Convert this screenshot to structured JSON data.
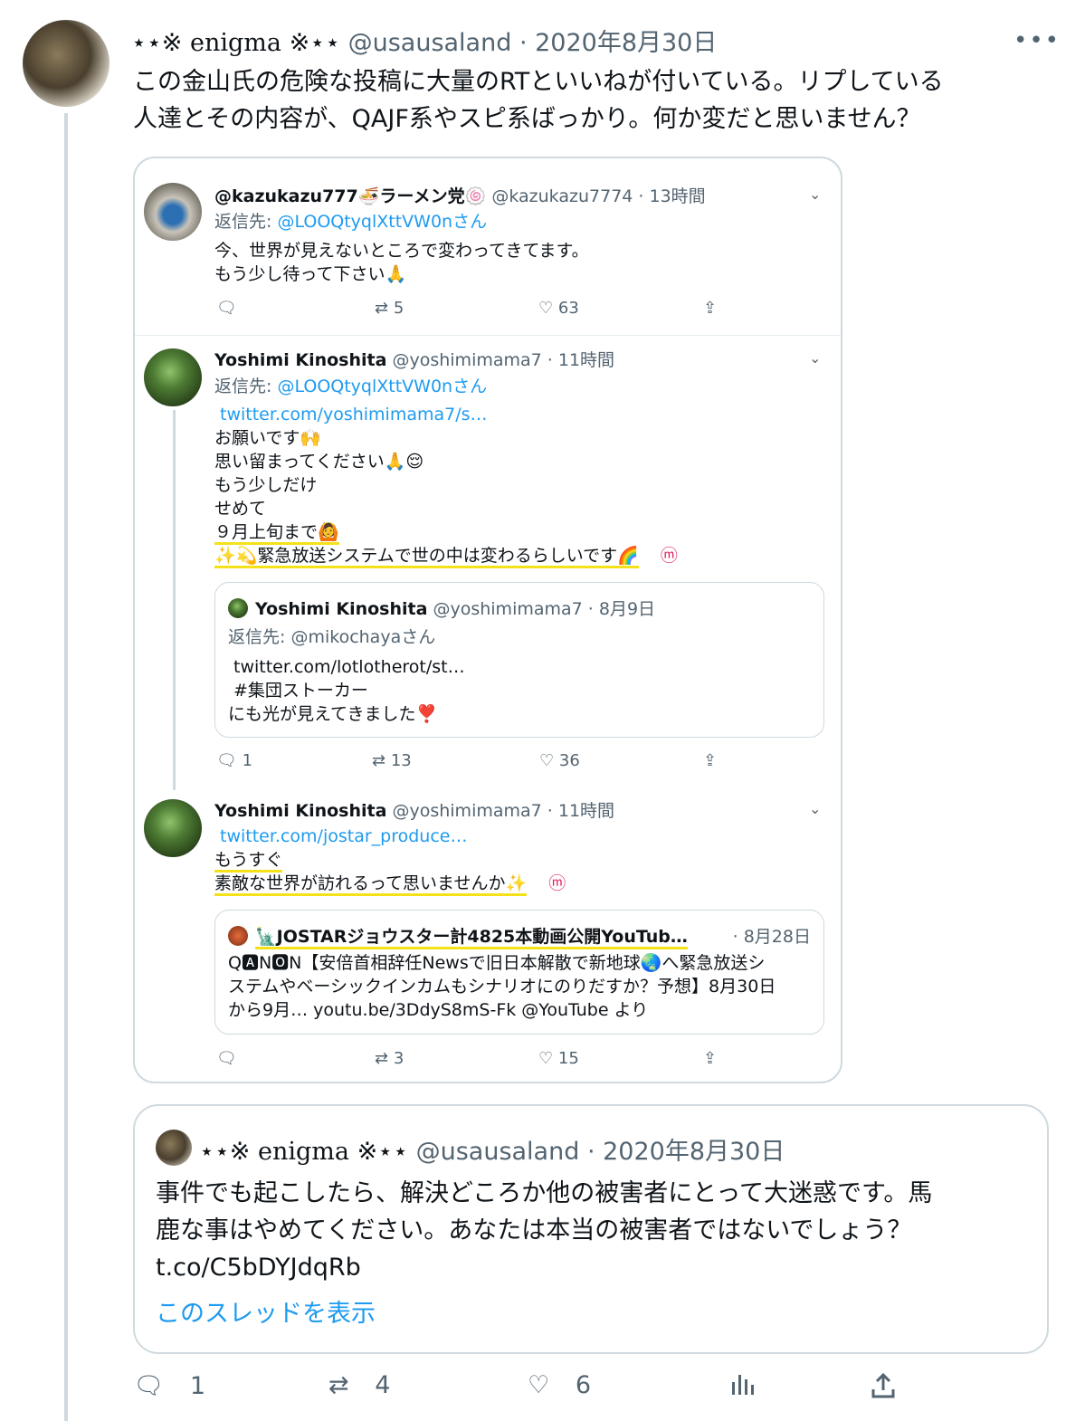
{
  "tweet": {
    "name": "⋆⋆※ enigma ※⋆⋆",
    "handle": "@usausaland",
    "date": "· 2020年8月30日",
    "more": "•••",
    "text_line1": "この金山氏の危険な投稿に大量のRTといいねが付いている。リプしている",
    "text_line2": "人達とその内容が、QAJF系やスピ系ばっかり。何か変だと思いません？"
  },
  "embed": {
    "t1": {
      "name": "@kazukazu777",
      "name_suffix": "🍜ラーメン党🍥",
      "handle": "@kazukazu7774",
      "time": "· 13時間",
      "reply_prefix": "返信先: ",
      "reply_to": "@LOOQtyqlXttVW0nさん",
      "line1": "今、世界が見えないところで変わってきてます。",
      "line2": "もう少し待って下さい🙏",
      "retweets": "5",
      "likes": "63"
    },
    "t2": {
      "name": "Yoshimi Kinoshita",
      "handle": "@yoshimimama7",
      "time": "· 11時間",
      "reply_prefix": "返信先: ",
      "reply_to": "@LOOQtyqlXttVW0nさん",
      "link": "twitter.com/yoshimimama7/s…",
      "line1": "お願いです🙌",
      "line2": "思い留まってください🙏😌",
      "line3": "もう少しだけ",
      "line4": "せめて",
      "line5": "９月上旬まで🙆",
      "line6": "✨💫緊急放送システムで世の中は変わるらしいです🌈",
      "quote": {
        "name": "Yoshimi Kinoshita",
        "handle": "@yoshimimama7",
        "date": "· 8月9日",
        "reply_prefix": "返信先: ",
        "reply_to": "@mikochayaさん",
        "link": "twitter.com/lotlotherot/st…",
        "line1": "#集団ストーカー",
        "line2": "にも光が見えてきました❣️"
      },
      "replies": "1",
      "retweets": "13",
      "likes": "36"
    },
    "t3": {
      "name": "Yoshimi Kinoshita",
      "handle": "@yoshimimama7",
      "time": "· 11時間",
      "link": "twitter.com/jostar_produce…",
      "line1": "もうすぐ",
      "line2": "素敵な世界が訪れるって思いませんか✨",
      "quote": {
        "name": "🗽JOSTARジョウスター計4825本動画公開YouTub…",
        "date": "· 8月28日",
        "line1": "Q🅰N🅾N【安倍首相辞任Newsで旧日本解散で新地球🌏へ緊急放送シ",
        "line2": "ステムやベーシックインカムもシナリオにのりだすか？予想】8月30日",
        "line3": "から9月…  youtu.be/3DdyS8mS-Fk   @YouTube より"
      },
      "retweets": "3",
      "likes": "15"
    },
    "badge": "ⓜ"
  },
  "quoted": {
    "name": "⋆⋆※ enigma ※⋆⋆",
    "handle": "@usausaland",
    "date": "· 2020年8月30日",
    "line1": "事件でも起こしたら、解決どころか他の被害者にとって大迷惑です。馬",
    "line2": "鹿な事はやめてください。あなたは本当の被害者ではないでしょう？",
    "line3": "t.co/C5bDYJdqRb",
    "show_thread": "このスレッドを表示"
  },
  "actions": {
    "replies": "1",
    "retweets": "4",
    "likes": "6"
  },
  "colors": {
    "link": "#1d9bf0",
    "secondary": "#536471",
    "highlight": "#f5e11a",
    "border": "#cfd9de"
  }
}
